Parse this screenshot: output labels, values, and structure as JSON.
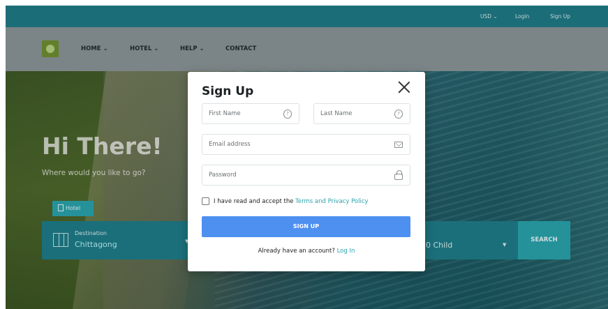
{
  "topbar": {
    "currency": "USD ⌄",
    "login": "Login",
    "signup": "Sign Up"
  },
  "nav": {
    "home": "HOME ⌄",
    "hotel": "HOTEL ⌄",
    "help": "HELP ⌄",
    "contact": "CONTACT"
  },
  "hero": {
    "title": "Hi There!",
    "subtitle": "Where would you like to go?"
  },
  "search": {
    "tab_label": "Hotel",
    "destination_label": "Destination",
    "destination_value": "Chittagong",
    "child_value": "0 Child",
    "search_button": "SEARCH"
  },
  "modal": {
    "title": "Sign Up",
    "first_name_placeholder": "First Name",
    "last_name_placeholder": "Last Name",
    "email_placeholder": "Email address",
    "password_placeholder": "Password",
    "terms_prefix": "I have read and accept the ",
    "terms_link": "Terms and Privacy Policy",
    "signup_button": "SIGN UP",
    "already_text": "Already have an account? ",
    "login_link": "Log In"
  },
  "colors": {
    "accent": "#2aa3ac",
    "primary_button": "#4d90f0",
    "topbar": "#1f7a86"
  }
}
